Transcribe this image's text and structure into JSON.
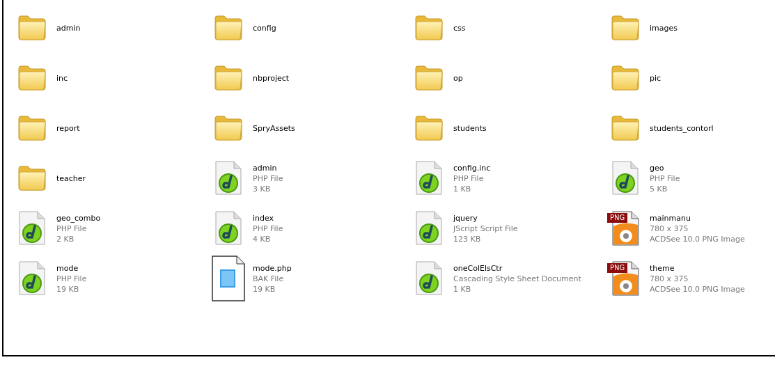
{
  "items": [
    {
      "kind": "folder",
      "name": "admin"
    },
    {
      "kind": "folder",
      "name": "config"
    },
    {
      "kind": "folder",
      "name": "css"
    },
    {
      "kind": "folder",
      "name": "images"
    },
    {
      "kind": "folder",
      "name": "inc"
    },
    {
      "kind": "folder",
      "name": "nbproject"
    },
    {
      "kind": "folder",
      "name": "op"
    },
    {
      "kind": "folder",
      "name": "pic"
    },
    {
      "kind": "folder",
      "name": "report"
    },
    {
      "kind": "folder",
      "name": "SpryAssets"
    },
    {
      "kind": "folder",
      "name": "students"
    },
    {
      "kind": "folder",
      "name": "students_contorl"
    },
    {
      "kind": "folder",
      "name": "teacher"
    },
    {
      "kind": "php",
      "name": "admin",
      "details": [
        "PHP File",
        "3 KB"
      ]
    },
    {
      "kind": "php",
      "name": "config.inc",
      "details": [
        "PHP File",
        "1 KB"
      ]
    },
    {
      "kind": "php",
      "name": "geo",
      "details": [
        "PHP File",
        "5 KB"
      ]
    },
    {
      "kind": "php",
      "name": "geo_combo",
      "details": [
        "PHP File",
        "2 KB"
      ]
    },
    {
      "kind": "php",
      "name": "index",
      "details": [
        "PHP File",
        "4 KB"
      ]
    },
    {
      "kind": "php",
      "name": "jquery",
      "details": [
        "JScript Script File",
        "123 KB"
      ]
    },
    {
      "kind": "png",
      "name": "mainmanu",
      "badge": "PNG",
      "details": [
        "780 x 375",
        "ACDSee 10.0 PNG Image"
      ]
    },
    {
      "kind": "php",
      "name": "mode",
      "details": [
        "PHP File",
        "19 KB"
      ]
    },
    {
      "kind": "bak",
      "name": "mode.php",
      "details": [
        "BAK File",
        "19 KB"
      ]
    },
    {
      "kind": "php",
      "name": "oneColElsCtr",
      "details": [
        "Cascading Style Sheet Document",
        "1 KB"
      ]
    },
    {
      "kind": "png",
      "name": "theme",
      "badge": "PNG",
      "details": [
        "780 x 375",
        "ACDSee 10.0 PNG Image"
      ]
    }
  ]
}
